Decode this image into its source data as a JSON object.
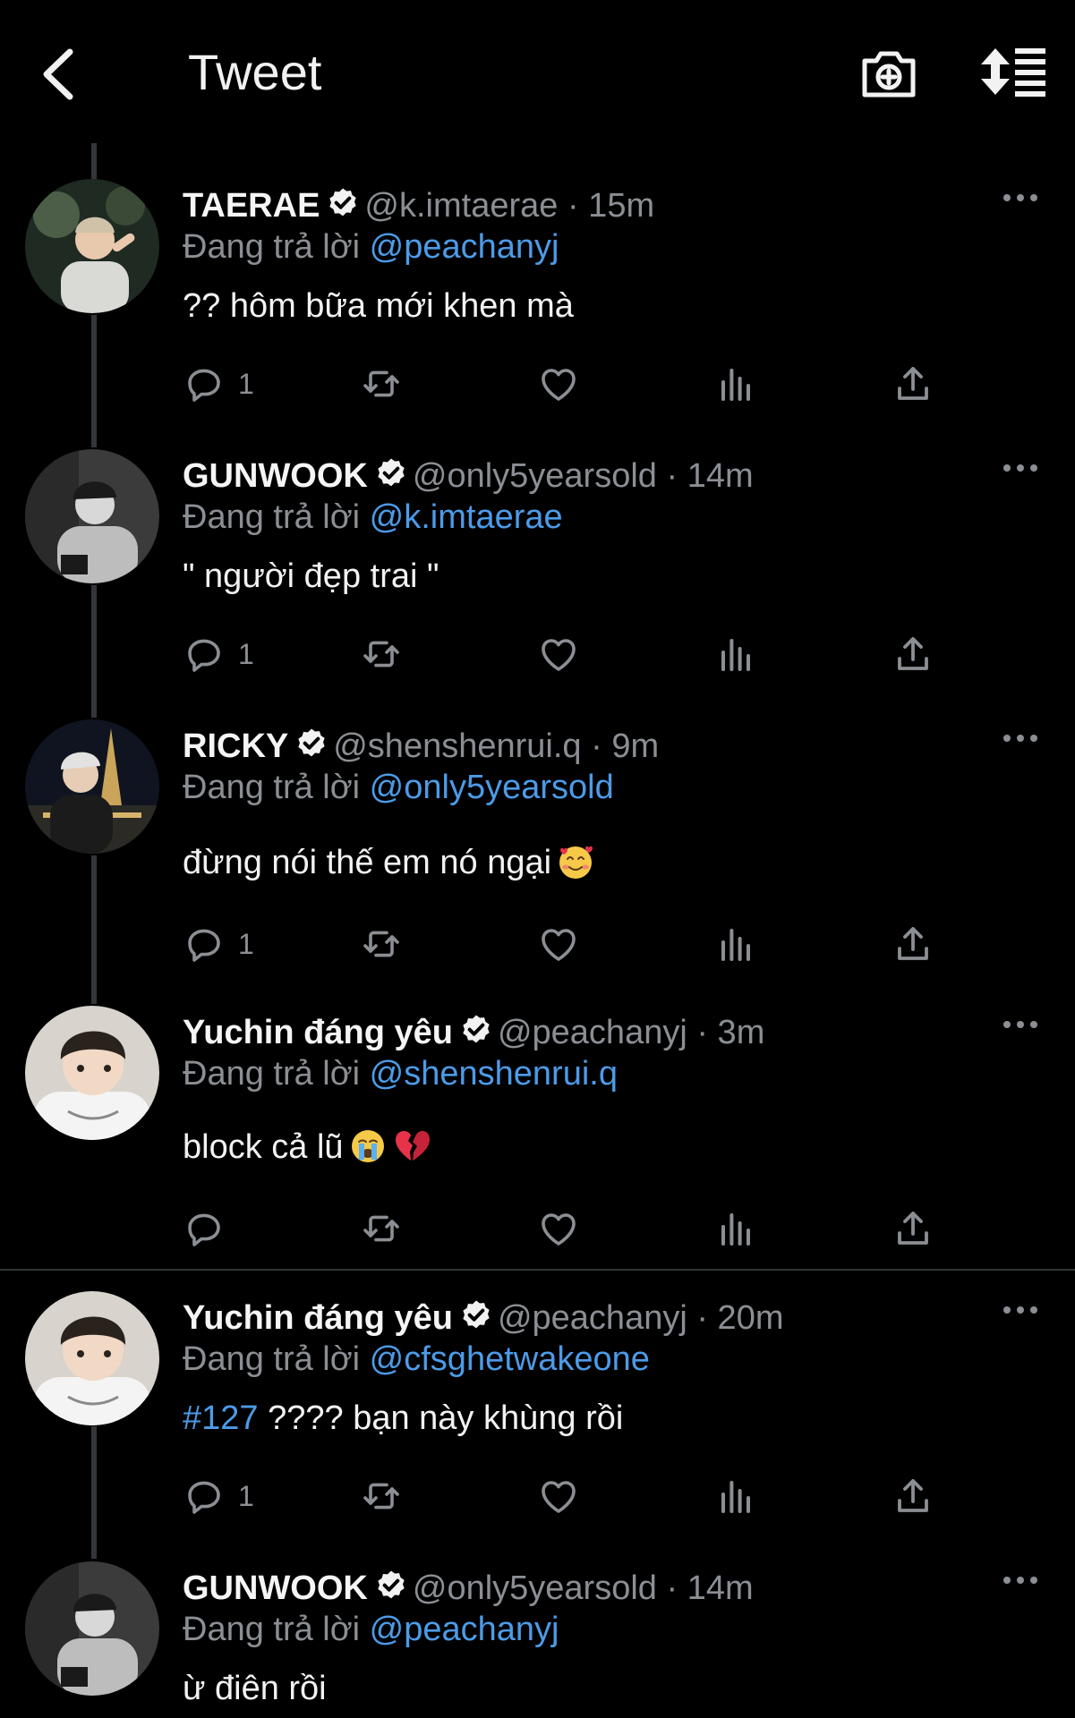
{
  "header": {
    "title": "Tweet"
  },
  "tweets": [
    {
      "name": "TAERAE",
      "handle": "@k.imtaerae",
      "time": "· 15m",
      "reply_prefix": "Đang trả lời",
      "reply_to": "@peachanyj",
      "hashtag": "",
      "text": "?? hôm bữa mới khen mà",
      "emojis": [],
      "reply_count": "1"
    },
    {
      "name": "GUNWOOK",
      "handle": "@only5yearsold",
      "time": "· 14m",
      "reply_prefix": "Đang trả lời",
      "reply_to": "@k.imtaerae",
      "hashtag": "",
      "text": "\" người đẹp trai \"",
      "emojis": [],
      "reply_count": "1"
    },
    {
      "name": "RICKY",
      "handle": "@shenshenrui.q",
      "time": "· 9m",
      "reply_prefix": "Đang trả lời",
      "reply_to": "@only5yearsold",
      "hashtag": "",
      "text": "đừng nói thế em nó ngại",
      "emojis": [
        "smiling-face-with-hearts"
      ],
      "reply_count": "1"
    },
    {
      "name": "Yuchin đáng yêu",
      "handle": "@peachanyj",
      "time": "· 3m",
      "reply_prefix": "Đang trả lời",
      "reply_to": "@shenshenrui.q",
      "hashtag": "",
      "text": "block cả lũ",
      "emojis": [
        "loudly-crying-face",
        "broken-heart"
      ],
      "reply_count": ""
    },
    {
      "name": "Yuchin đáng yêu",
      "handle": "@peachanyj",
      "time": "· 20m",
      "reply_prefix": "Đang trả lời",
      "reply_to": "@cfsghetwakeone",
      "hashtag": "#127",
      "text": " ???? bạn này khùng rồi",
      "emojis": [],
      "reply_count": "1"
    },
    {
      "name": "GUNWOOK",
      "handle": "@only5yearsold",
      "time": "· 14m",
      "reply_prefix": "Đang trả lời",
      "reply_to": "@peachanyj",
      "hashtag": "",
      "text": "ừ điên rồi",
      "emojis": [],
      "reply_count": ""
    }
  ],
  "icons": [
    "back-arrow-icon",
    "camera-plus-icon",
    "sort-list-icon",
    "verified-badge-icon",
    "more-icon",
    "reply-icon",
    "retweet-icon",
    "like-icon",
    "views-icon",
    "share-icon"
  ],
  "colors": {
    "background": "#000000",
    "link": "#4c9be8",
    "muted": "#8b8f94",
    "text": "#f2f2f2"
  }
}
